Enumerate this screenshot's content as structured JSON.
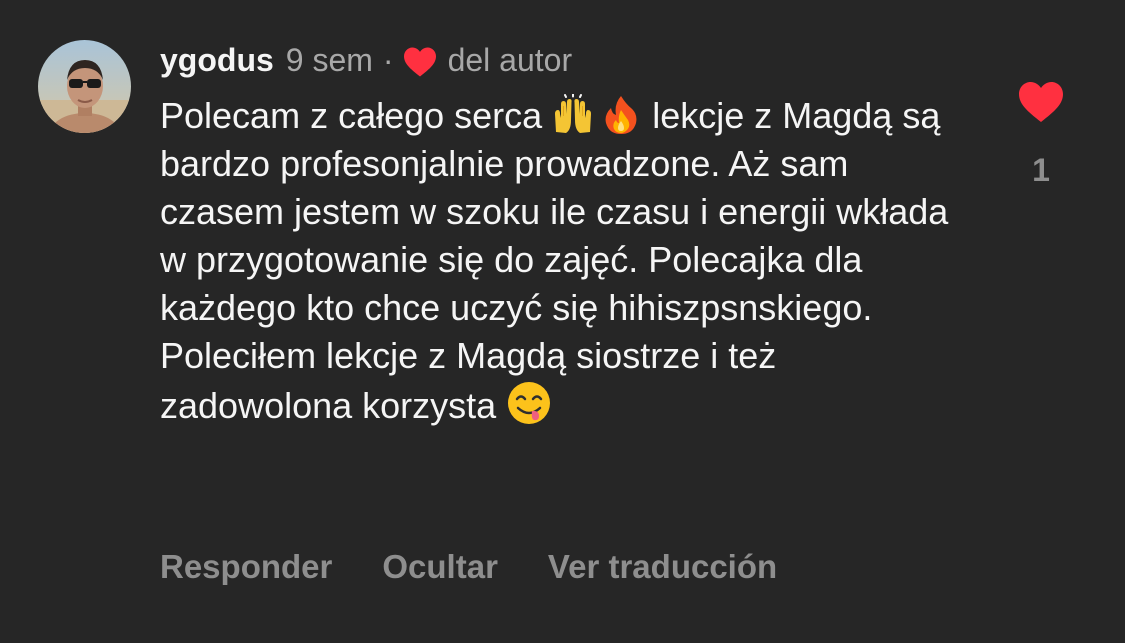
{
  "comment": {
    "username": "ygodus",
    "time_ago": "9 sem",
    "separator": "·",
    "author_label": "del autor",
    "text_part1": "Polecam z całego serca",
    "emoji_1": "raising-hands-emoji",
    "emoji_2": "fire-emoji",
    "text_part2": " lekcje z Magdą są bardzo profesonjalnie prowadzone. Aż sam czasem jestem w szoku ile czasu i energii wkłada w przygotowanie się do zajęć. Polecajka dla każdego kto chce uczyć się hihiszpsnskiego. Poleciłem lekcje z Magdą siostrze i też zadowolona korzysta ",
    "emoji_3": "face-savoring-food-emoji"
  },
  "like": {
    "count": "1",
    "icon": "heart-filled-icon",
    "color": "#ff3040"
  },
  "actions": {
    "reply": "Responder",
    "hide": "Ocultar",
    "translate": "Ver traducción"
  },
  "colors": {
    "background": "#262626",
    "primary_text": "#f5f5f5",
    "secondary_text": "#a8a8a8",
    "heart": "#ff3040"
  }
}
